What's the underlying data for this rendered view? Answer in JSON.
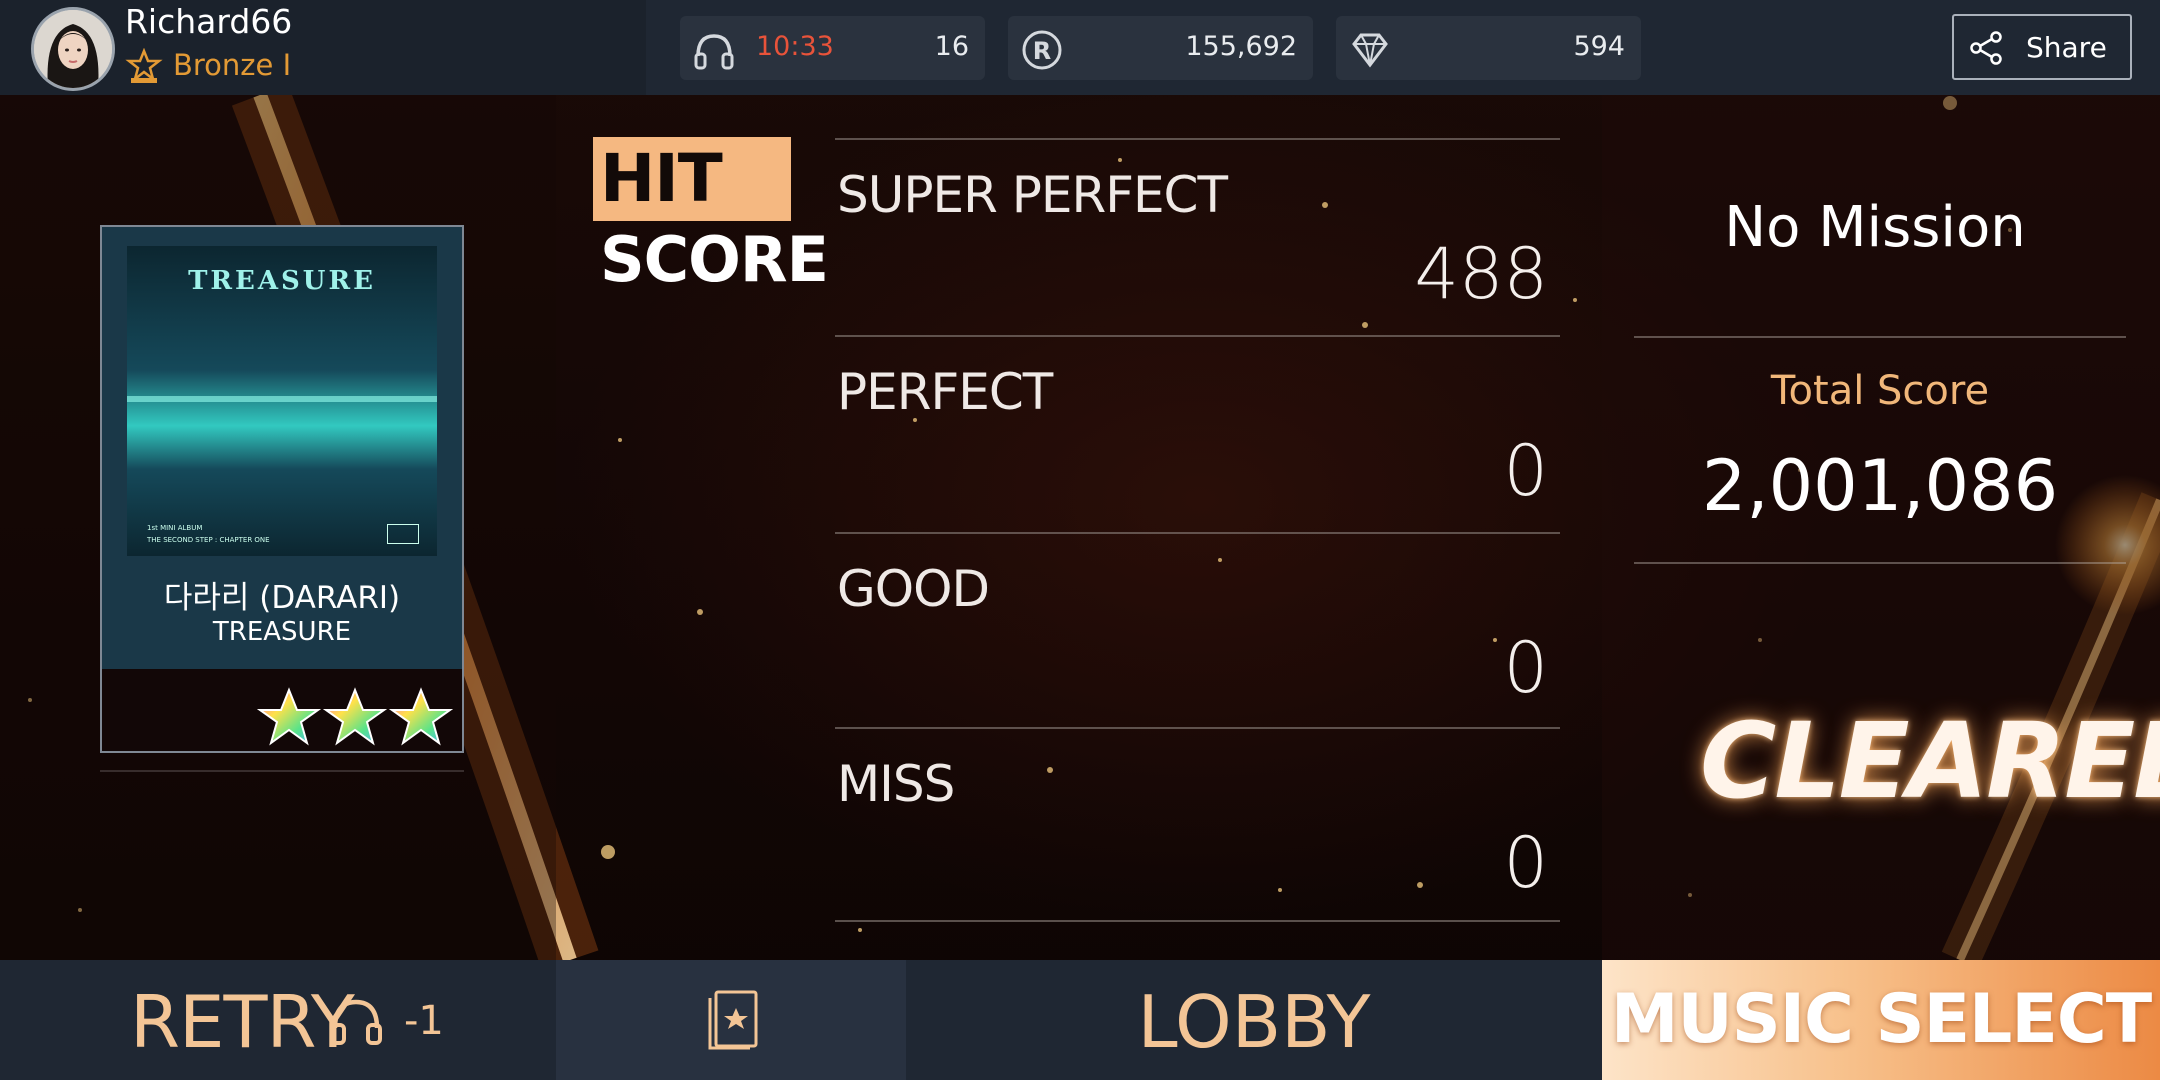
{
  "profile": {
    "username": "Richard66",
    "rank": "Bronze I"
  },
  "stats": {
    "headphones_timer": "10:33",
    "headphones_count": "16",
    "r_currency": "155,692",
    "diamonds": "594"
  },
  "share_label": "Share",
  "album": {
    "cover_brand": "TREASURE",
    "cover_line1": "1st MINI ALBUM",
    "cover_line2": "THE SECOND STEP : CHAPTER ONE",
    "title": "다라리 (DARARI)",
    "artist": "TREASURE",
    "stars": 3
  },
  "hit_score": {
    "label_hit": "HIT",
    "label_score": "SCORE",
    "rows": [
      {
        "name": "SUPER PERFECT",
        "value": "488"
      },
      {
        "name": "PERFECT",
        "value": "0"
      },
      {
        "name": "GOOD",
        "value": "0"
      },
      {
        "name": "MISS",
        "value": "0"
      }
    ]
  },
  "result": {
    "mission": "No Mission",
    "total_label": "Total Score",
    "total_value": "2,001,086",
    "status": "CLEARED"
  },
  "bottom": {
    "retry_label": "RETRY",
    "retry_cost": "-1",
    "lobby_label": "LOBBY",
    "music_select_label": "MUSIC SELECT"
  },
  "colors": {
    "accent_orange": "#f5b881",
    "timer_red": "#e8533a",
    "rank_orange": "#e39a35",
    "button_text": "#f3c596"
  },
  "icons": [
    "avatar",
    "bronze-rank-icon",
    "headphones-icon",
    "r-coin-icon",
    "diamond-icon",
    "share-icon",
    "star-icon",
    "favorite-card-icon"
  ]
}
